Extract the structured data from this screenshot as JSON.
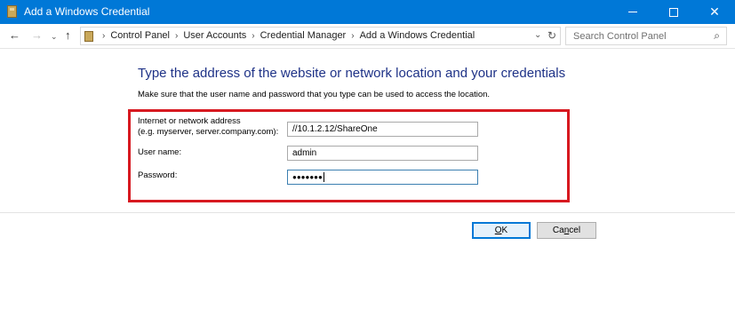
{
  "window": {
    "title": "Add a Windows Credential",
    "controls": {
      "minimize": "minimize",
      "maximize": "maximize",
      "close": "✕"
    }
  },
  "navbar": {
    "breadcrumbs": [
      "Control Panel",
      "User Accounts",
      "Credential Manager",
      "Add a Windows Credential"
    ],
    "search_placeholder": "Search Control Panel"
  },
  "form": {
    "heading": "Type the address of the website or network location and your credentials",
    "instruction": "Make sure that the user name and password that you type can be used to access the location.",
    "address_label_line1": "Internet or network address",
    "address_label_line2": "(e.g. myserver, server.company.com):",
    "address_value": "//10.1.2.12/ShareOne",
    "username_label": "User name:",
    "username_value": "admin",
    "password_label": "Password:",
    "password_mask": "●●●●●●●"
  },
  "buttons": {
    "ok": {
      "prefix": "",
      "accel": "O",
      "suffix": "K"
    },
    "cancel": {
      "prefix": "Ca",
      "accel": "n",
      "suffix": "cel"
    }
  },
  "colors": {
    "titlebar": "#0078d7",
    "heading": "#1e3287",
    "highlight_frame": "#d71920"
  }
}
